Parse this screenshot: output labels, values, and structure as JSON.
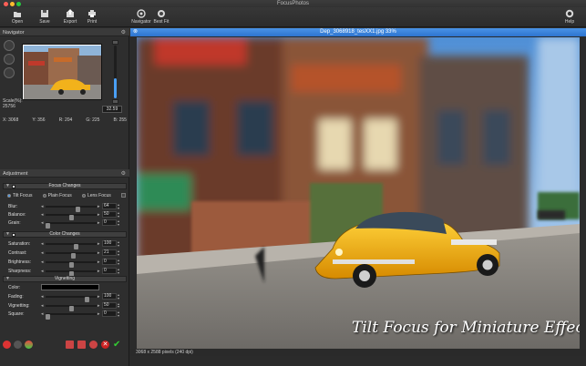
{
  "window": {
    "title": "FocusPhotos"
  },
  "toolbar": {
    "left": [
      {
        "label": "Open",
        "icon": "open-icon"
      },
      {
        "label": "Save",
        "icon": "save-icon"
      },
      {
        "label": "Export",
        "icon": "export-icon"
      },
      {
        "label": "Print",
        "icon": "print-icon"
      }
    ],
    "right": [
      {
        "label": "Navigator",
        "icon": "navigator-icon"
      },
      {
        "label": "Best Fit",
        "icon": "best-fit-icon"
      }
    ],
    "help": {
      "label": "Help",
      "icon": "help-icon"
    }
  },
  "navigator": {
    "title": "Navigator",
    "scale_label": "Scale(%):",
    "scale_value": "25756",
    "zoom": "32.59",
    "zoom_level": 0.38,
    "coords": {
      "x": "X: 3068",
      "y": "Y: 356",
      "r": "R: 204",
      "g": "G: 225",
      "b": "B: 255"
    }
  },
  "adjustment": {
    "title": "Adjustment",
    "focus": {
      "title": "Focus Changes",
      "modes": [
        "Tilt Focus",
        "Plain Focus",
        "Lens Focus"
      ],
      "sliders": [
        {
          "label": "Blur:",
          "value": "64",
          "level": 0.64
        },
        {
          "label": "Balance:",
          "value": "50",
          "level": 0.5
        },
        {
          "label": "Grain:",
          "value": "0",
          "level": 0.0
        }
      ]
    },
    "color": {
      "title": "Color Changes",
      "sliders": [
        {
          "label": "Saturation:",
          "value": "100",
          "level": 0.6
        },
        {
          "label": "Contrast:",
          "value": "21",
          "level": 0.55
        },
        {
          "label": "Brightness:",
          "value": "0",
          "level": 0.5
        },
        {
          "label": "Sharpness:",
          "value": "0",
          "level": 0.5
        }
      ]
    },
    "vignetting": {
      "title": "Vignetting",
      "color_label": "Color:",
      "color_value": "#000000",
      "sliders": [
        {
          "label": "Fading:",
          "value": "100",
          "level": 0.85
        },
        {
          "label": "Vignetting:",
          "value": "50",
          "level": 0.5
        },
        {
          "label": "Square:",
          "value": "0",
          "level": 0.0
        }
      ]
    }
  },
  "document": {
    "title": "Dep_3068918_tesXX1.jpg 33%",
    "caption": "Tilt Focus  for Miniature Effects",
    "status": "3068 x 2588 pixels (240 dpi)"
  },
  "colors": {
    "accent": "#4a9ff5",
    "titlebar": "#2d74cf",
    "taxi": "#f2b21b"
  }
}
